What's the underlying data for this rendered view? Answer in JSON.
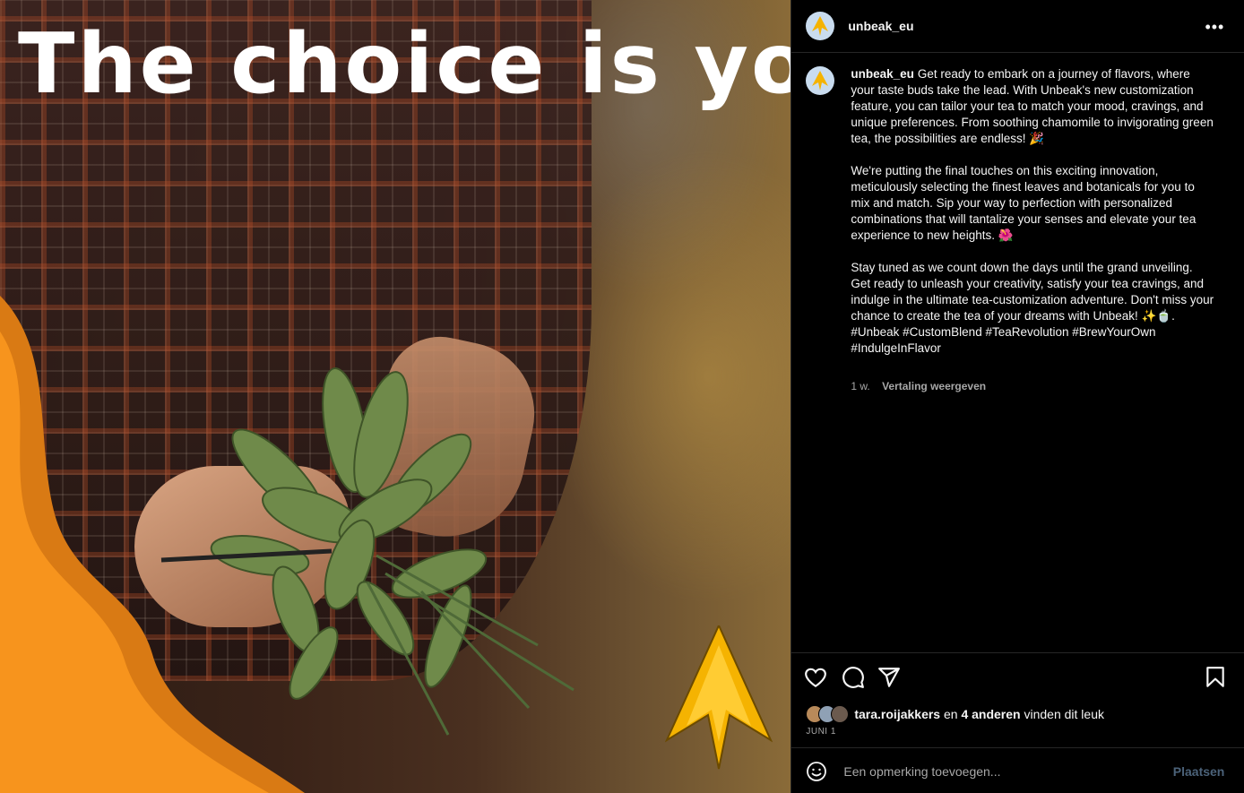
{
  "media": {
    "headline": "The choice is yours",
    "colors": {
      "orange": "#f7941d",
      "orange_dark": "#d97a14",
      "logo_yellow": "#f5b301"
    }
  },
  "post": {
    "username": "unbeak_eu",
    "more_icon": "more-horizontal-icon",
    "caption": {
      "username": "unbeak_eu",
      "paragraph1": "Get ready to embark on a journey of flavors, where your taste buds take the lead. With Unbeak's new customization feature, you can tailor your tea to match your mood, cravings, and unique preferences. From soothing chamomile to invigorating green tea, the possibilities are endless! 🎉",
      "paragraph2": "We're putting the final touches on this exciting innovation, meticulously selecting the finest leaves and botanicals for you to mix and match. Sip your way to perfection with personalized combinations that will tantalize your senses and elevate your tea experience to new heights. 🌺",
      "paragraph3": "Stay tuned as we count down the days until the grand unveiling. Get ready to unleash your creativity, satisfy your tea cravings, and indulge in the ultimate tea-customization adventure. Don't miss your chance to create the tea of your dreams with Unbeak! ✨🍵.",
      "hashtags": "#Unbeak #CustomBlend #TeaRevolution #BrewYourOwn #IndulgeInFlavor"
    },
    "time_ago": "1 w.",
    "translate_label": "Vertaling weergeven",
    "likes": {
      "user": "tara.roijakkers",
      "connector": "en",
      "others": "4 anderen",
      "suffix": "vinden dit leuk"
    },
    "date": "JUNI 1",
    "comment": {
      "placeholder": "Een opmerking toevoegen...",
      "post_label": "Plaatsen"
    }
  }
}
